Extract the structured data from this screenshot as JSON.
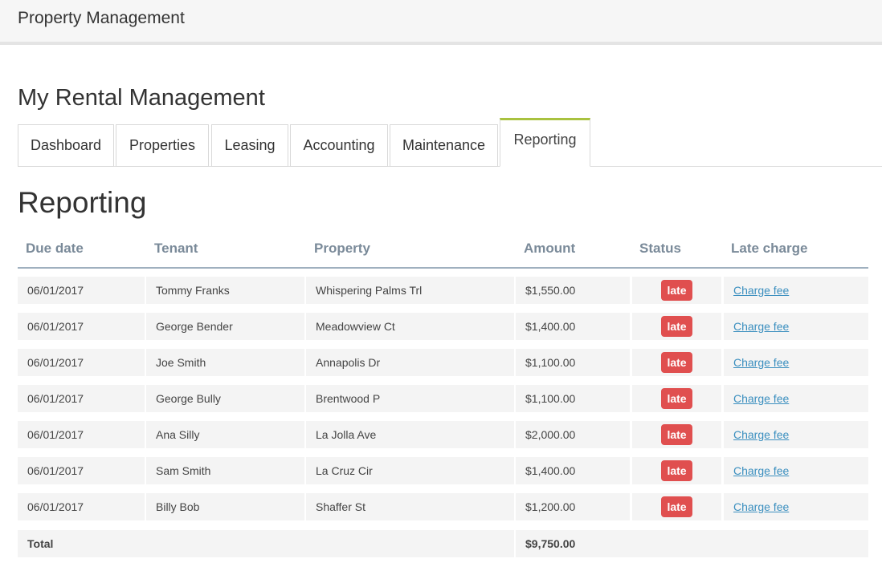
{
  "app": {
    "title": "Property Management"
  },
  "page": {
    "heading": "My Rental Management"
  },
  "tabs": [
    {
      "label": "Dashboard",
      "active": false
    },
    {
      "label": "Properties",
      "active": false
    },
    {
      "label": "Leasing",
      "active": false
    },
    {
      "label": "Accounting",
      "active": false
    },
    {
      "label": "Maintenance",
      "active": false
    },
    {
      "label": "Reporting",
      "active": true
    }
  ],
  "section": {
    "title": "Reporting"
  },
  "table": {
    "headers": {
      "due_date": "Due date",
      "tenant": "Tenant",
      "property": "Property",
      "amount": "Amount",
      "status": "Status",
      "late_charge": "Late charge"
    },
    "rows": [
      {
        "due_date": "06/01/2017",
        "tenant": "Tommy Franks",
        "property": "Whispering Palms Trl",
        "amount": "$1,550.00",
        "status": "late",
        "action": "Charge fee"
      },
      {
        "due_date": "06/01/2017",
        "tenant": "George Bender",
        "property": "Meadowview Ct",
        "amount": "$1,400.00",
        "status": "late",
        "action": "Charge fee"
      },
      {
        "due_date": "06/01/2017",
        "tenant": "Joe Smith",
        "property": "Annapolis Dr",
        "amount": "$1,100.00",
        "status": "late",
        "action": "Charge fee"
      },
      {
        "due_date": "06/01/2017",
        "tenant": "George Bully",
        "property": "Brentwood P",
        "amount": "$1,100.00",
        "status": "late",
        "action": "Charge fee"
      },
      {
        "due_date": "06/01/2017",
        "tenant": "Ana Silly",
        "property": "La Jolla Ave",
        "amount": "$2,000.00",
        "status": "late",
        "action": "Charge fee"
      },
      {
        "due_date": "06/01/2017",
        "tenant": "Sam Smith",
        "property": "La Cruz Cir",
        "amount": "$1,400.00",
        "status": "late",
        "action": "Charge fee"
      },
      {
        "due_date": "06/01/2017",
        "tenant": "Billy Bob",
        "property": "Shaffer St",
        "amount": "$1,200.00",
        "status": "late",
        "action": "Charge fee"
      }
    ],
    "total": {
      "label": "Total",
      "amount": "$9,750.00"
    }
  },
  "colors": {
    "accent": "#a9c23f",
    "badge_late": "#e04f4f",
    "link": "#3b8fbf",
    "header_text": "#7a8a99"
  }
}
